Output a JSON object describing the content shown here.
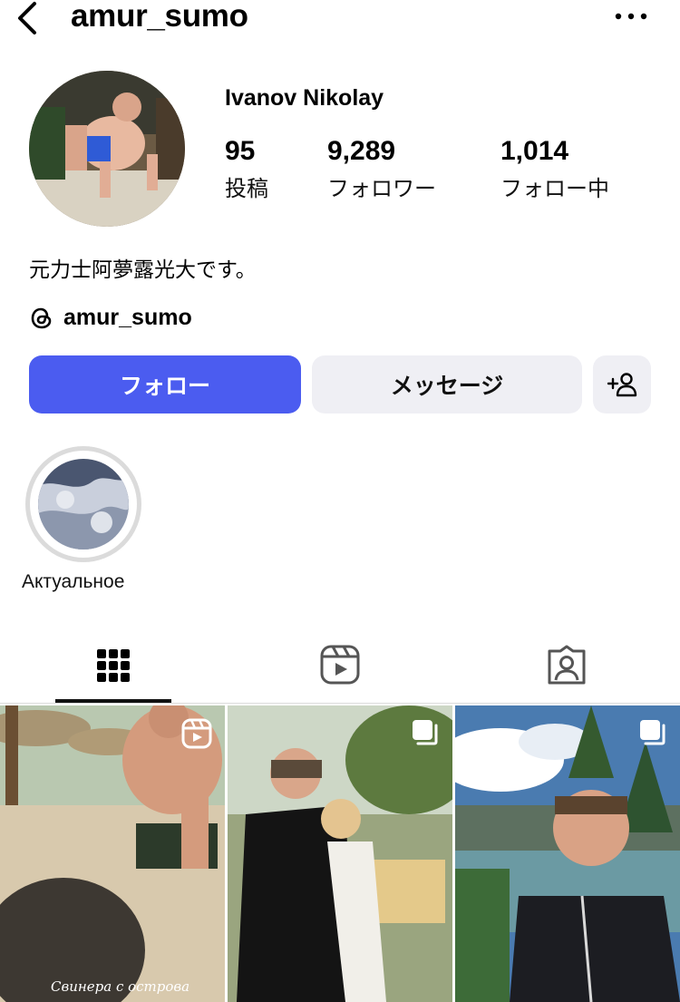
{
  "header": {
    "username": "amur_sumo",
    "back_icon": "chevron-left-icon",
    "more_icon": "more-dots-icon"
  },
  "profile": {
    "display_name": "Ivanov Nikolay",
    "stats": [
      {
        "value": "95",
        "label": "投稿"
      },
      {
        "value": "9,289",
        "label": "フォロワー"
      },
      {
        "value": "1,014",
        "label": "フォロー中"
      }
    ],
    "bio": "元力士阿夢露光大です。",
    "threads_handle": "amur_sumo"
  },
  "actions": {
    "follow_label": "フォロー",
    "message_label": "メッセージ",
    "suggest_icon": "add-person-icon",
    "follow_color": "#4b5cf0"
  },
  "highlights": [
    {
      "label": "Актуальное"
    }
  ],
  "tabs": [
    {
      "icon": "grid-icon",
      "active": true
    },
    {
      "icon": "reels-icon",
      "active": false
    },
    {
      "icon": "tagged-icon",
      "active": false
    }
  ],
  "posts": [
    {
      "type": "reel",
      "caption": "Свинера с острова",
      "badge_icon": "reel-badge-icon"
    },
    {
      "type": "carousel",
      "badge_icon": "carousel-badge-icon"
    },
    {
      "type": "carousel",
      "badge_icon": "carousel-badge-icon"
    }
  ]
}
